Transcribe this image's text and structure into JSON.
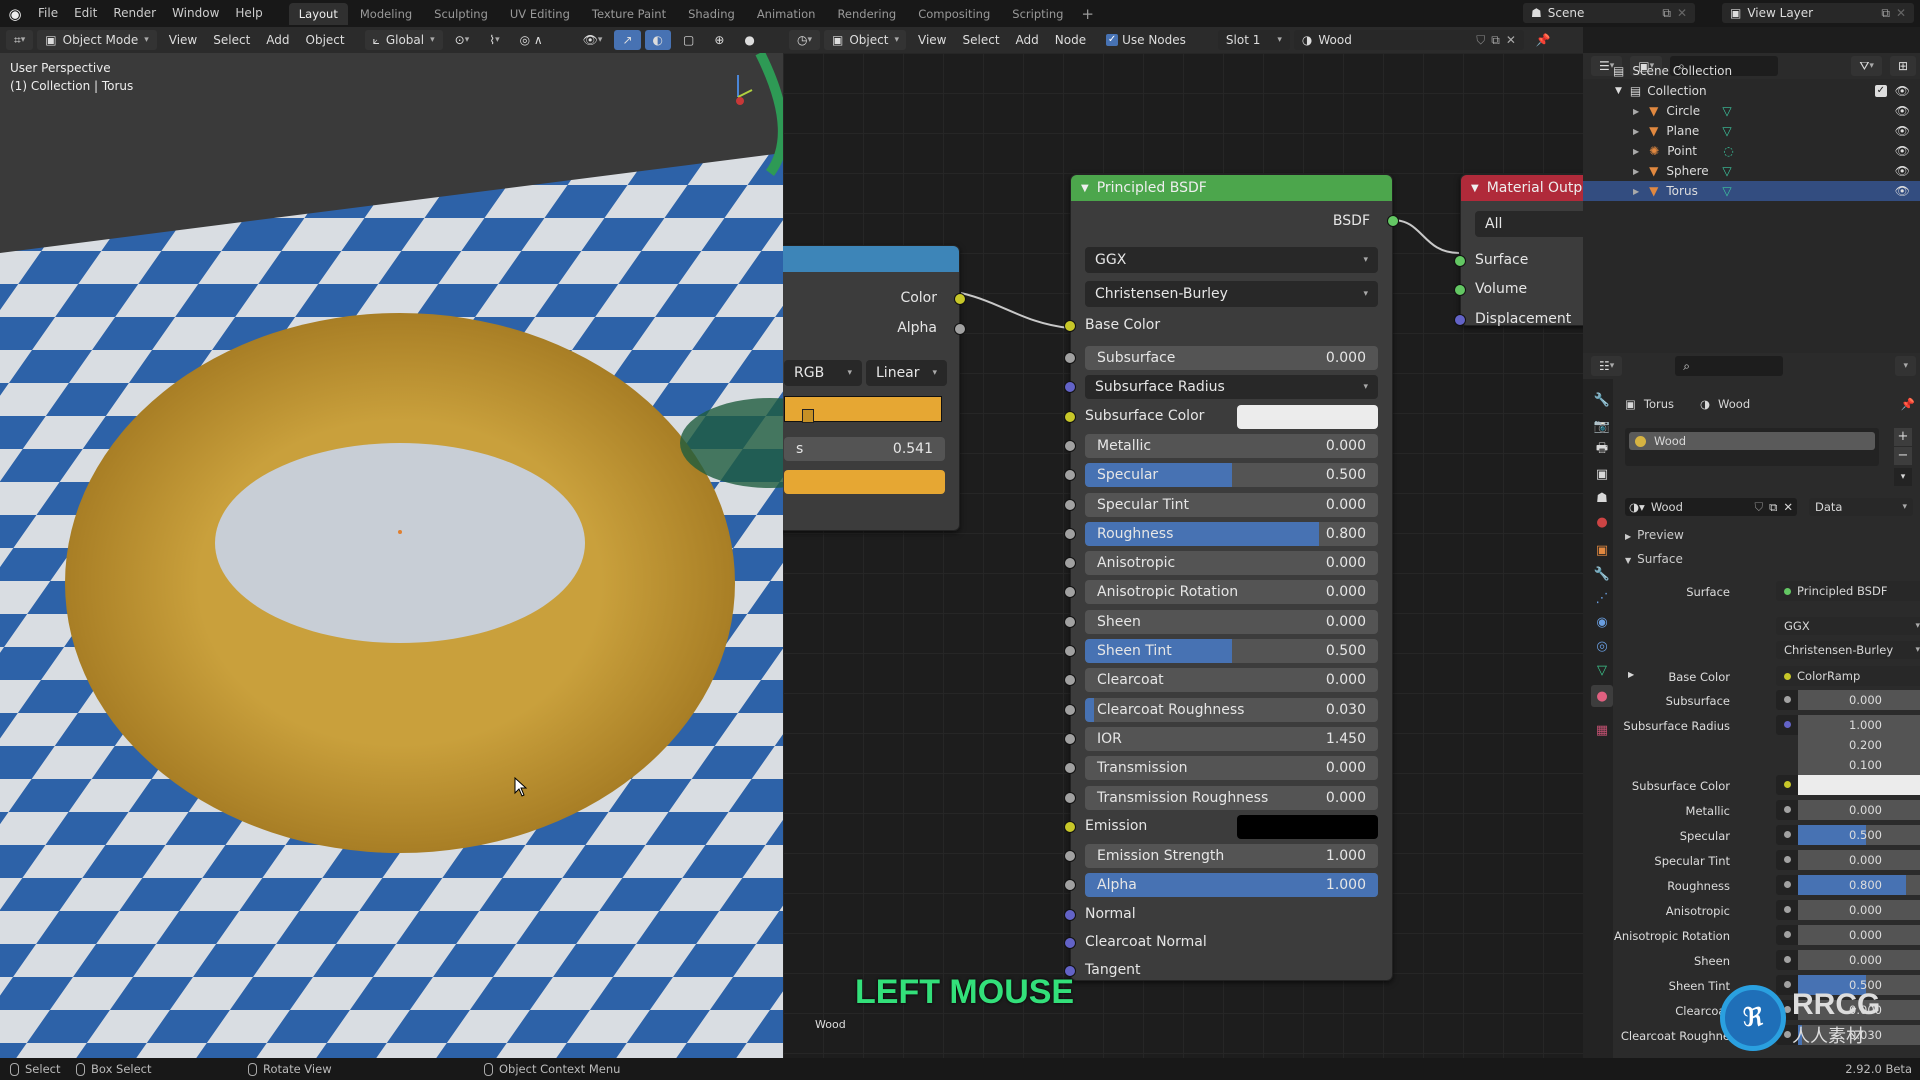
{
  "topbar": {
    "menus": [
      "File",
      "Edit",
      "Render",
      "Window",
      "Help"
    ],
    "workspaces": [
      "Layout",
      "Modeling",
      "Sculpting",
      "UV Editing",
      "Texture Paint",
      "Shading",
      "Animation",
      "Rendering",
      "Compositing",
      "Scripting"
    ],
    "active_workspace": "Layout",
    "add_workspace": "+",
    "scene": "Scene",
    "view_layer": "View Layer"
  },
  "viewport_header": {
    "mode": "Object Mode",
    "menus": [
      "View",
      "Select",
      "Add",
      "Object"
    ],
    "orientation": "Global"
  },
  "viewport": {
    "view_name": "User Perspective",
    "collection_info": "(1) Collection | Torus",
    "watermark": "RRCG"
  },
  "node_header": {
    "type": "Object",
    "menus": [
      "View",
      "Select",
      "Add",
      "Node"
    ],
    "use_nodes_label": "Use Nodes",
    "use_nodes": true,
    "slot": "Slot 1",
    "material": "Wood"
  },
  "colorramp_node": {
    "outputs": [
      "Color",
      "Alpha"
    ],
    "color_mode": "RGB",
    "interpolation": "Linear",
    "pos_label": "s",
    "pos_value": "0.541",
    "stop_color": "#e6a733"
  },
  "bsdf_node": {
    "title": "Principled BSDF",
    "output": "BSDF",
    "distribution": "GGX",
    "subsurface_method": "Christensen-Burley",
    "base_color_label": "Base Color",
    "subsurface_radius_label": "Subsurface Radius",
    "subsurface_color_label": "Subsurface Color",
    "emission_label": "Emission",
    "sliders": [
      {
        "label": "Subsurface",
        "value": "0.000",
        "fill": 0
      },
      {
        "label": "Metallic",
        "value": "0.000",
        "fill": 0
      },
      {
        "label": "Specular",
        "value": "0.500",
        "fill": 0.5
      },
      {
        "label": "Specular Tint",
        "value": "0.000",
        "fill": 0
      },
      {
        "label": "Roughness",
        "value": "0.800",
        "fill": 0.8
      },
      {
        "label": "Anisotropic",
        "value": "0.000",
        "fill": 0
      },
      {
        "label": "Anisotropic Rotation",
        "value": "0.000",
        "fill": 0
      },
      {
        "label": "Sheen",
        "value": "0.000",
        "fill": 0
      },
      {
        "label": "Sheen Tint",
        "value": "0.500",
        "fill": 0.5
      },
      {
        "label": "Clearcoat",
        "value": "0.000",
        "fill": 0
      },
      {
        "label": "Clearcoat Roughness",
        "value": "0.030",
        "fill": 0.03
      },
      {
        "label": "IOR",
        "value": "1.450",
        "fill": 0
      },
      {
        "label": "Transmission",
        "value": "0.000",
        "fill": 0
      },
      {
        "label": "Transmission Roughness",
        "value": "0.000",
        "fill": 0
      },
      {
        "label": "Emission Strength",
        "value": "1.000",
        "fill": 0
      },
      {
        "label": "Alpha",
        "value": "1.000",
        "fill": 1
      }
    ],
    "vector_inputs": [
      "Normal",
      "Clearcoat Normal",
      "Tangent"
    ]
  },
  "output_node": {
    "title": "Material Outpu",
    "target": "All",
    "inputs": [
      "Surface",
      "Volume",
      "Displacement"
    ]
  },
  "node_editor": {
    "overlay_text": "LEFT MOUSE",
    "material_label": "Wood"
  },
  "outliner": {
    "root": "Scene Collection",
    "collection": "Collection",
    "items": [
      {
        "name": "Circle",
        "type": "mesh"
      },
      {
        "name": "Plane",
        "type": "mesh"
      },
      {
        "name": "Point",
        "type": "light"
      },
      {
        "name": "Sphere",
        "type": "mesh"
      },
      {
        "name": "Torus",
        "type": "mesh",
        "selected": true
      }
    ]
  },
  "properties": {
    "object": "Torus",
    "material": "Wood",
    "slot_item": "Wood",
    "material_name": "Wood",
    "link": "Data",
    "panels": [
      "Preview",
      "Surface"
    ],
    "surface_label": "Surface",
    "surface_value": "Principled BSDF",
    "distribution": "GGX",
    "subsurface_method": "Christensen-Burley",
    "base_color_label": "Base Color",
    "base_color_value": "ColorRamp",
    "rows": [
      {
        "label": "Subsurface",
        "value": "0.000",
        "fill": 0
      },
      {
        "label": "Subsurface Radius",
        "value": "1.000",
        "fill": 0
      },
      {
        "label": "",
        "value": "0.200",
        "fill": 0
      },
      {
        "label": "",
        "value": "0.100",
        "fill": 0
      },
      {
        "label": "Subsurface Color",
        "value": "",
        "fill": 0
      },
      {
        "label": "Metallic",
        "value": "0.000",
        "fill": 0
      },
      {
        "label": "Specular",
        "value": "0.500",
        "fill": 0.5
      },
      {
        "label": "Specular Tint",
        "value": "0.000",
        "fill": 0
      },
      {
        "label": "Roughness",
        "value": "0.800",
        "fill": 0.8
      },
      {
        "label": "Anisotropic",
        "value": "0.000",
        "fill": 0
      },
      {
        "label": "Anisotropic Rotation",
        "value": "0.000",
        "fill": 0
      },
      {
        "label": "Sheen",
        "value": "0.000",
        "fill": 0
      },
      {
        "label": "Sheen Tint",
        "value": "0.500",
        "fill": 0.5
      },
      {
        "label": "Clearcoat",
        "value": "0.000",
        "fill": 0
      },
      {
        "label": "Clearcoat Roughne",
        "value": "0.030",
        "fill": 0.03
      }
    ]
  },
  "statusbar": {
    "select": "Select",
    "box_select": "Box Select",
    "rotate_view": "Rotate View",
    "context_menu": "Object Context Menu",
    "version": "2.92.0 Beta"
  },
  "watermark_logo": {
    "line1": "RRCG",
    "line2": "人人素材"
  }
}
